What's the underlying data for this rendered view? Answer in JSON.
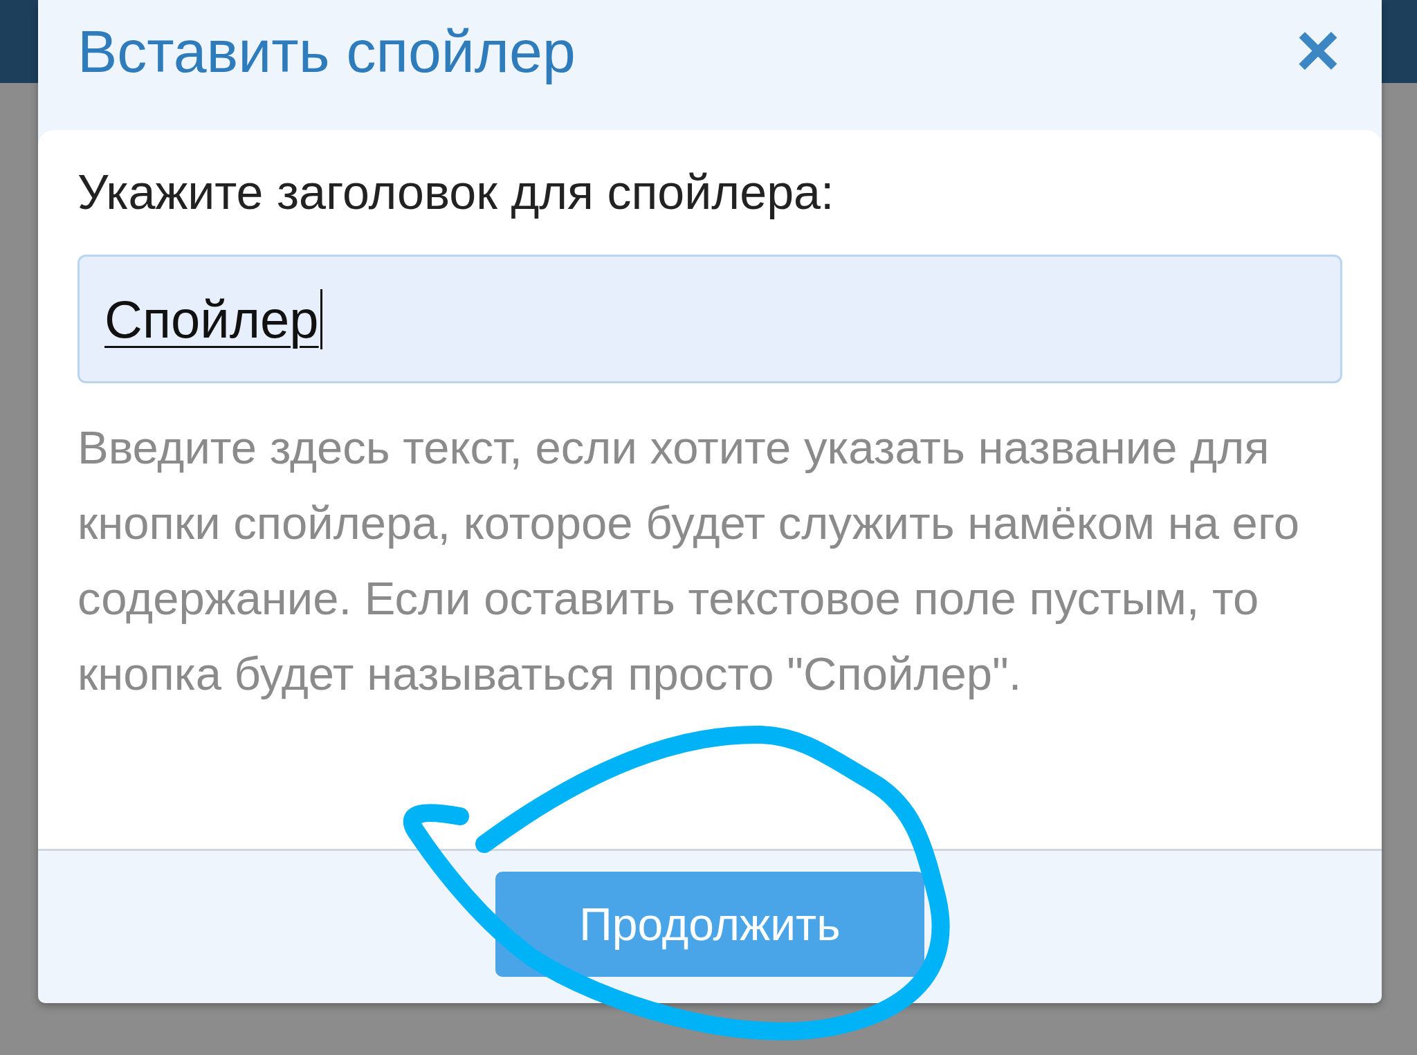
{
  "dialog": {
    "title": "Вставить спойлер",
    "close": "×",
    "label": "Укажите заголовок для спойлера:",
    "field": {
      "value": "Спойлер"
    },
    "hint": "Введите здесь текст, если хотите указать название для кнопки спойлера, которое будет служить намёком на его содержание. Если оставить текстовое поле пустым, то кнопка будет называться просто \"Спойлер\".",
    "button": "Продолжить"
  }
}
